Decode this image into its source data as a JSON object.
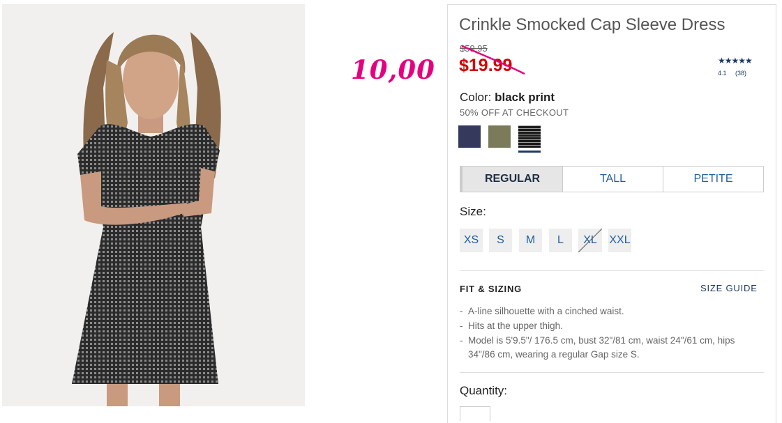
{
  "annotation": {
    "handwritten_price": "10,00"
  },
  "product": {
    "title": "Crinkle Smocked Cap Sleeve Dress",
    "old_price": "$59.95",
    "new_price": "$19.99",
    "rating": {
      "stars": "★★★★★",
      "value": "4.1",
      "count": "(38)"
    },
    "color_label": "Color:",
    "color_value": "black print",
    "promo": "50% OFF AT CHECKOUT",
    "swatches": [
      {
        "color": "#35395b"
      },
      {
        "color": "#7b7b5c"
      },
      {
        "color": "#222222",
        "selected": true
      }
    ]
  },
  "fit_options": [
    "REGULAR",
    "TALL",
    "PETITE"
  ],
  "size_label": "Size:",
  "sizes": [
    {
      "label": "XS"
    },
    {
      "label": "S"
    },
    {
      "label": "M"
    },
    {
      "label": "L"
    },
    {
      "label": "XL",
      "unavailable": true
    },
    {
      "label": "XXL"
    }
  ],
  "fit_section": {
    "title": "FIT & SIZING",
    "size_guide": "SIZE GUIDE",
    "bullets": [
      "A-line silhouette with a cinched waist.",
      "Hits at the upper thigh.",
      "Model is 5'9.5\"/ 176.5 cm, bust 32\"/81 cm, waist 24\"/61 cm, hips 34\"/86 cm, wearing a regular Gap size S."
    ]
  },
  "quantity_label": "Quantity:",
  "colors": {
    "accent": "#1d3966",
    "sale": "#d40000",
    "annotation": "#e6007e"
  }
}
